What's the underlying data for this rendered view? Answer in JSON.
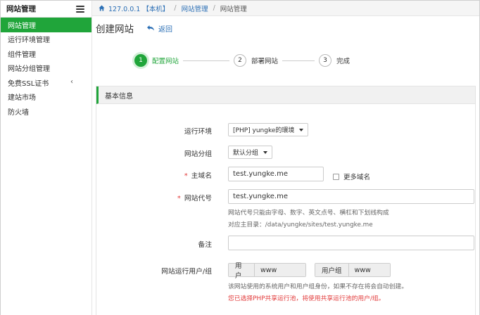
{
  "sidebar": {
    "title": "网站管理",
    "items": [
      {
        "label": "网站管理",
        "active": true
      },
      {
        "label": "运行环境管理"
      },
      {
        "label": "组件管理"
      },
      {
        "label": "网站分组管理"
      },
      {
        "label": "免费SSL证书"
      },
      {
        "label": "建站市场"
      },
      {
        "label": "防火墙"
      }
    ],
    "expand_chevron": "‹"
  },
  "breadcrumb": {
    "host": "127.0.0.1 【本机】",
    "section": "网站管理",
    "current": "网站管理"
  },
  "page": {
    "title": "创建网站",
    "back_label": "返回"
  },
  "steps": [
    {
      "num": "1",
      "label": "配置网站",
      "active": true
    },
    {
      "num": "2",
      "label": "部署网站"
    },
    {
      "num": "3",
      "label": "完成"
    }
  ],
  "panel": {
    "title": "基本信息"
  },
  "form": {
    "runtime": {
      "label": "运行环境",
      "value": "[PHP] yungke的環境"
    },
    "group": {
      "label": "网站分组",
      "value": "默认分组"
    },
    "domain": {
      "label": "主域名",
      "value": "test.yungke.me",
      "more_label": "更多域名"
    },
    "code": {
      "label": "网站代号",
      "value": "test.yungke.me",
      "hint1": "网站代号只能由字母、数字、英文点号、横杠和下划线构成",
      "hint2": "对应主目录：/data/yungke/sites/test.yungke.me"
    },
    "remark": {
      "label": "备注",
      "value": ""
    },
    "user": {
      "label": "网站运行用户/组",
      "user_prefix": "用户",
      "user_value": "www",
      "group_prefix": "用户组",
      "group_value": "www",
      "hint": "该网站使用的系统用户和用户组身份，如果不存在将会自动创建。",
      "warning": "您已选择PHP共享运行池，将使用共享运行池的用户/组。"
    }
  },
  "colors": {
    "accent": "#20a53a",
    "link": "#2b6fb5",
    "required": "#e23b3b"
  }
}
